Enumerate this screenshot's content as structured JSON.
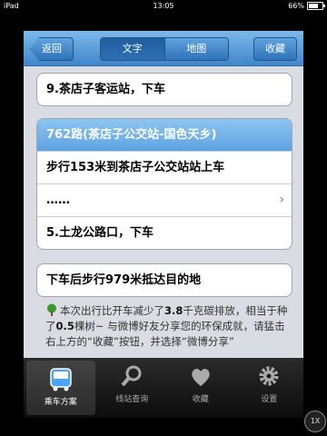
{
  "status": {
    "device": "iPad",
    "time": "13:05",
    "battery": "66%"
  },
  "nav": {
    "back": "返回",
    "tabs": [
      "文字",
      "地图"
    ],
    "favorite": "收藏"
  },
  "step_top": "9.茶店子客运站，下车",
  "route": {
    "header": "762路(茶店子公交站-国色天乡)",
    "walk": "步行153米到茶店子公交站站上车",
    "more": "……",
    "alight": "5.土龙公路口，下车"
  },
  "final": "下车后步行979米抵达目的地",
  "eco": {
    "p1": "本次出行比开车减少了",
    "carbon": "3.8",
    "p2": "千克碳排放，相当于种了",
    "trees": "0.5",
    "p3": "棵树~ 与微博好友分享您的环保成就，请猛击右上方的“收藏”按钮，并选择“微博分享”"
  },
  "tabbar": {
    "items": [
      "乘车方案",
      "线站查询",
      "收藏",
      "设置"
    ],
    "active": 0
  },
  "zoom": "1X",
  "colors": {
    "accent": "#3f86cb",
    "header_row": "#5ea3e2"
  }
}
